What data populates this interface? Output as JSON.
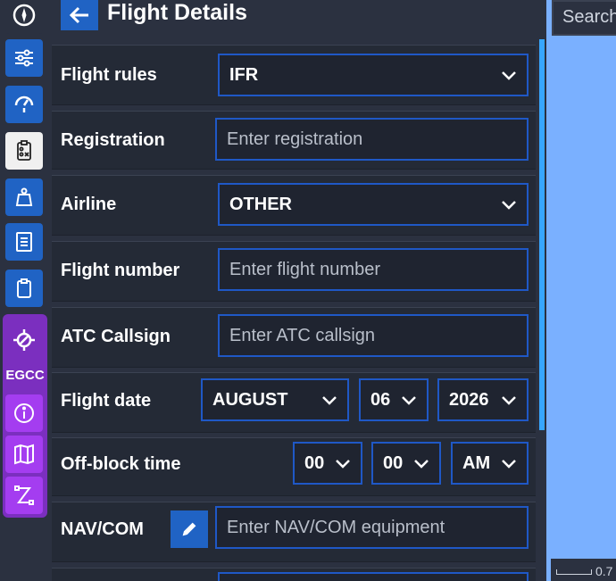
{
  "header": {
    "title": "Flight Details"
  },
  "sidebar": {
    "airport_code": "EGCC"
  },
  "form": {
    "flight_rules": {
      "label": "Flight rules",
      "value": "IFR"
    },
    "registration": {
      "label": "Registration",
      "placeholder": "Enter registration"
    },
    "airline": {
      "label": "Airline",
      "value": "OTHER"
    },
    "flight_number": {
      "label": "Flight number",
      "placeholder": "Enter flight number"
    },
    "atc_callsign": {
      "label": "ATC Callsign",
      "placeholder": "Enter ATC callsign"
    },
    "flight_date": {
      "label": "Flight date",
      "month": "AUGUST",
      "day": "06",
      "year": "2026"
    },
    "off_block": {
      "label": "Off-block time",
      "hour": "00",
      "minute": "00",
      "ampm": "AM"
    },
    "navcom": {
      "label": "NAV/COM",
      "placeholder": "Enter NAV/COM equipment"
    }
  },
  "map": {
    "search_placeholder": "Search",
    "scale_label": "0.7"
  },
  "colors": {
    "accent_blue": "#2063c4",
    "purple": "#7b2fbf",
    "map": "#7ab0ff"
  }
}
